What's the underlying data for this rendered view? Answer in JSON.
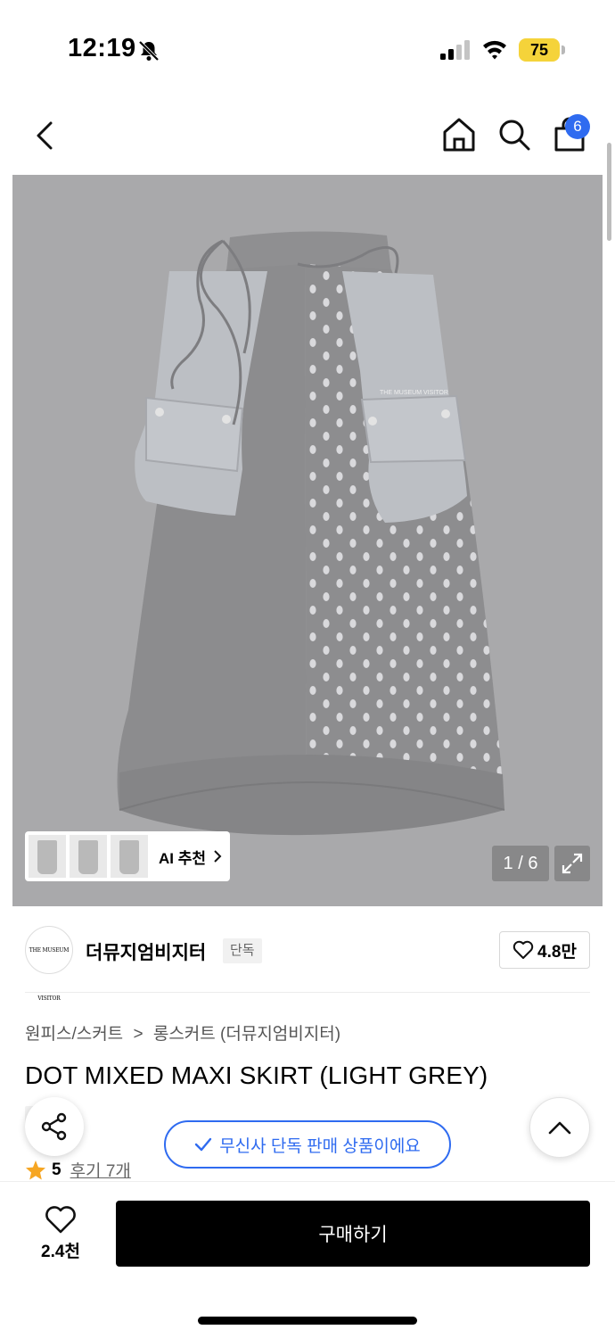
{
  "status_bar": {
    "time": "12:19",
    "battery": "75"
  },
  "nav": {
    "cart_count": "6",
    "icons": [
      "back-icon",
      "home-icon",
      "search-icon",
      "shopping-bag-icon"
    ]
  },
  "gallery": {
    "ai_label": "AI 추천",
    "page_counter": "1 / 6",
    "logo_text": "THE MUSEUM VISITOR"
  },
  "brand": {
    "name": "더뮤지엄비지터",
    "tag": "단독",
    "likes": "4.8만",
    "logo_text": "THE MUSEUM VISITOR"
  },
  "product": {
    "breadcrumb_category": "원피스/스커트",
    "breadcrumb_separator": ">",
    "breadcrumb_sub": "롱스커트 (더뮤지엄비지터)",
    "title": "DOT MIXED MAXI SKIRT (LIGHT GREY)",
    "exclusive_tag": "단독",
    "rating": "5",
    "reviews": "후기 7개"
  },
  "banner": {
    "text": "무신사 단독 판매 상품이에요"
  },
  "bottom": {
    "wish_count": "2.4천",
    "buy_label": "구매하기"
  },
  "colors": {
    "accent_blue": "#2f6bf0",
    "battery_yellow": "#f5d33a",
    "star": "#f6a623"
  }
}
